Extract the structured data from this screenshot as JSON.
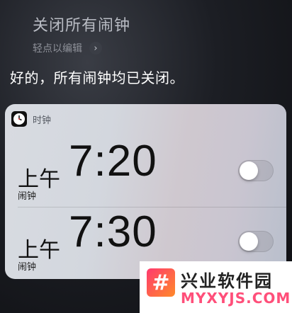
{
  "siri": {
    "query": "关闭所有闹钟",
    "edit_hint": "轻点以编辑",
    "response": "好的，所有闹钟均已关闭。"
  },
  "card": {
    "app_name": "时钟",
    "alarms": [
      {
        "ampm": "上午",
        "time": "7:20",
        "label": "闹钟",
        "enabled": false
      },
      {
        "ampm": "上午",
        "time": "7:30",
        "label": "闹钟",
        "enabled": false
      }
    ]
  },
  "watermark": {
    "title": "兴业软件园",
    "url": "MYXYJS.COM",
    "logo_glyph": "#"
  },
  "colors": {
    "brand_watermark": "#ff4f7a"
  }
}
